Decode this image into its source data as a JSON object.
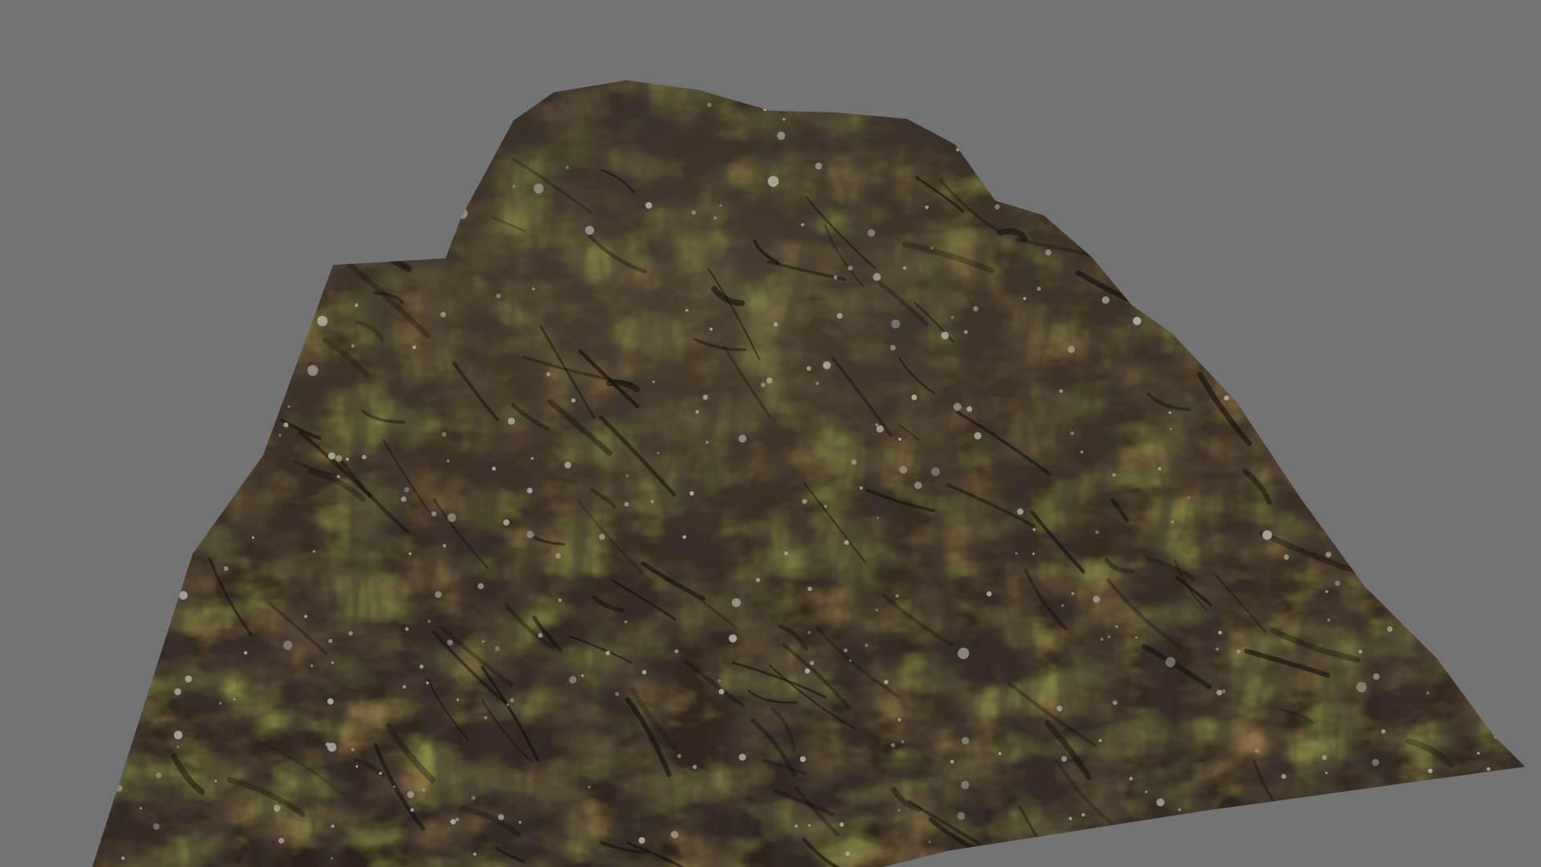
{
  "scene": {
    "subject": "rock-mound-icon",
    "colors": {
      "background": "#737373",
      "rock_dark": "#2e2620",
      "rock_mid": "#5a4634",
      "rust": "#9a5e22",
      "rust_light": "#b8742c",
      "moss": "#7a8a1e",
      "moss_light": "#9cab2a",
      "lichen": "#e8e6dc",
      "shadow": "#15120e"
    }
  }
}
